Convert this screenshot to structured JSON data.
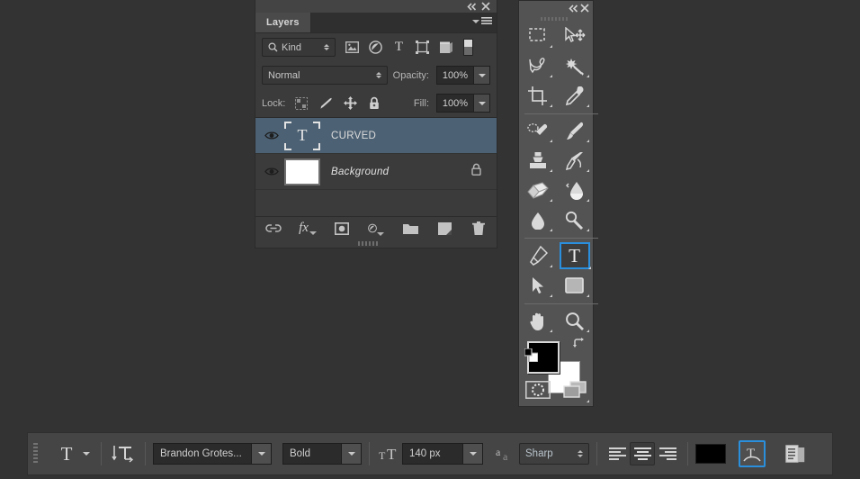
{
  "app": {
    "background_color": "#333333",
    "accent_color": "#2a8fdd"
  },
  "layers_panel": {
    "titlebar": {
      "collapse_icon": "collapse-double-left-icon",
      "close_icon": "close-icon"
    },
    "tab_label": "Layers",
    "menu_icon": "panel-menu-icon",
    "filter": {
      "kind_label": "Kind",
      "search_icon": "search-icon",
      "icons": [
        "pixel-layer-filter-icon",
        "adjustment-layer-filter-icon",
        "type-layer-filter-icon",
        "shape-layer-filter-icon",
        "smart-object-filter-icon"
      ],
      "toggle_icon": "filter-enable-toggle"
    },
    "blend": {
      "mode": "Normal",
      "opacity_label": "Opacity:",
      "opacity_value": "100%"
    },
    "lock": {
      "label": "Lock:",
      "icons": [
        "lock-transparent-pixels-icon",
        "lock-image-pixels-icon",
        "lock-position-icon",
        "lock-all-icon"
      ],
      "fill_label": "Fill:",
      "fill_value": "100%"
    },
    "layers": [
      {
        "name": "CURVED",
        "thumb": "type-layer-thumbnail",
        "visible": true,
        "selected": true,
        "locked": false,
        "italic": false
      },
      {
        "name": "Background",
        "thumb": "white-background-thumbnail",
        "visible": true,
        "selected": false,
        "locked": true,
        "italic": true
      }
    ],
    "footer_icons": [
      "link-layers-icon",
      "layer-style-fx-icon",
      "add-layer-mask-icon",
      "new-adjustment-layer-icon",
      "new-group-icon",
      "new-layer-icon",
      "delete-layer-icon"
    ]
  },
  "tools_panel": {
    "titlebar": {
      "collapse_icon": "collapse-double-left-icon",
      "close_icon": "close-icon"
    },
    "tools": [
      {
        "name": "rectangular-marquee-tool",
        "has_flyout": true
      },
      {
        "name": "move-tool",
        "has_flyout": false
      },
      {
        "name": "lasso-tool",
        "has_flyout": true
      },
      {
        "name": "magic-wand-tool",
        "has_flyout": true
      },
      {
        "name": "crop-tool",
        "has_flyout": true
      },
      {
        "name": "eyedropper-tool",
        "has_flyout": true
      },
      {
        "name": "spot-healing-brush-tool",
        "has_flyout": true
      },
      {
        "name": "brush-tool",
        "has_flyout": true
      },
      {
        "name": "clone-stamp-tool",
        "has_flyout": true
      },
      {
        "name": "history-brush-tool",
        "has_flyout": true
      },
      {
        "name": "eraser-tool",
        "has_flyout": true
      },
      {
        "name": "gradient-tool",
        "has_flyout": true
      },
      {
        "name": "blur-tool",
        "has_flyout": true
      },
      {
        "name": "dodge-tool",
        "has_flyout": true
      },
      {
        "name": "pen-tool",
        "has_flyout": true
      },
      {
        "name": "horizontal-type-tool",
        "has_flyout": true,
        "active": true
      },
      {
        "name": "path-selection-tool",
        "has_flyout": true
      },
      {
        "name": "rectangle-tool",
        "has_flyout": true
      },
      {
        "name": "hand-tool",
        "has_flyout": true
      },
      {
        "name": "zoom-tool",
        "has_flyout": true
      }
    ],
    "colors": {
      "foreground": "#000000",
      "background": "#ffffff",
      "swap_icon": "swap-colors-icon",
      "default_icon": "default-colors-icon"
    },
    "modes": [
      {
        "name": "quick-mask-mode-icon"
      },
      {
        "name": "screen-mode-icon",
        "has_flyout": true
      }
    ]
  },
  "options_bar": {
    "grip_icon": "drag-grip-icon",
    "tool_preset": {
      "icon": "type-tool-icon",
      "dropdown_icon": "chevron-down-icon"
    },
    "orientation": {
      "icon": "toggle-text-orientation-icon"
    },
    "font_family": {
      "value": "Brandon Grotes...",
      "dropdown_icon": "chevron-down-icon"
    },
    "font_style": {
      "value": "Bold",
      "dropdown_icon": "chevron-down-icon"
    },
    "font_size": {
      "icon": "font-size-icon",
      "value": "140 px",
      "dropdown_icon": "chevron-down-icon"
    },
    "anti_alias": {
      "icon": "anti-aliasing-icon",
      "value": "Sharp"
    },
    "alignment": [
      {
        "name": "align-left-button",
        "selected": false
      },
      {
        "name": "align-center-button",
        "selected": true
      },
      {
        "name": "align-right-button",
        "selected": false
      }
    ],
    "text_color": {
      "name": "text-color-swatch",
      "value": "#000000"
    },
    "warp_text": {
      "name": "warp-text-button",
      "focused": true
    },
    "panels_toggle": {
      "name": "toggle-character-paragraph-panels-button"
    }
  }
}
